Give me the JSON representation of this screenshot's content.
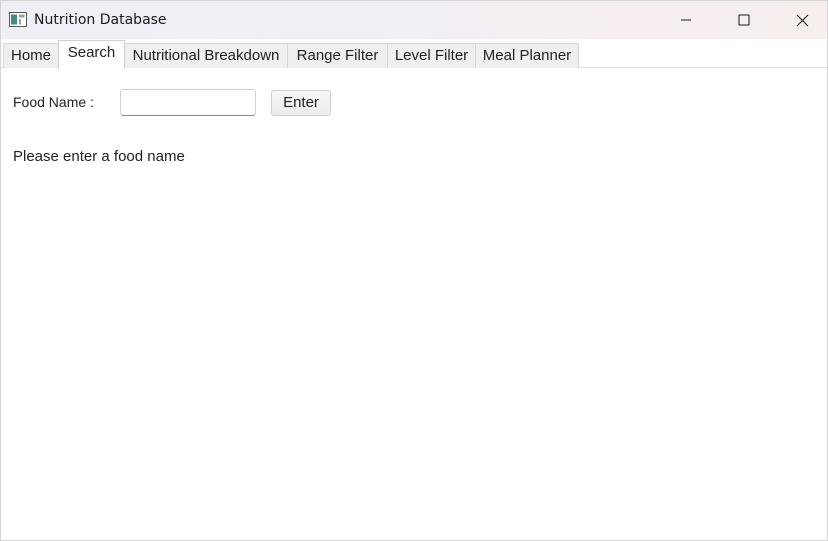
{
  "window": {
    "title": "Nutrition Database",
    "app_icon": "java-app-icon",
    "controls": {
      "minimize_icon": "minimize-icon",
      "maximize_icon": "maximize-icon",
      "close_icon": "close-icon"
    }
  },
  "tabs": [
    {
      "label": "Home",
      "active": false
    },
    {
      "label": "Search",
      "active": true
    },
    {
      "label": "Nutritional Breakdown",
      "active": false
    },
    {
      "label": "Range Filter",
      "active": false
    },
    {
      "label": "Level Filter",
      "active": false
    },
    {
      "label": "Meal Planner",
      "active": false
    }
  ],
  "search": {
    "food_name_label": "Food Name :",
    "food_name_value": "",
    "enter_label": "Enter",
    "status_message": "Please enter a food name"
  }
}
